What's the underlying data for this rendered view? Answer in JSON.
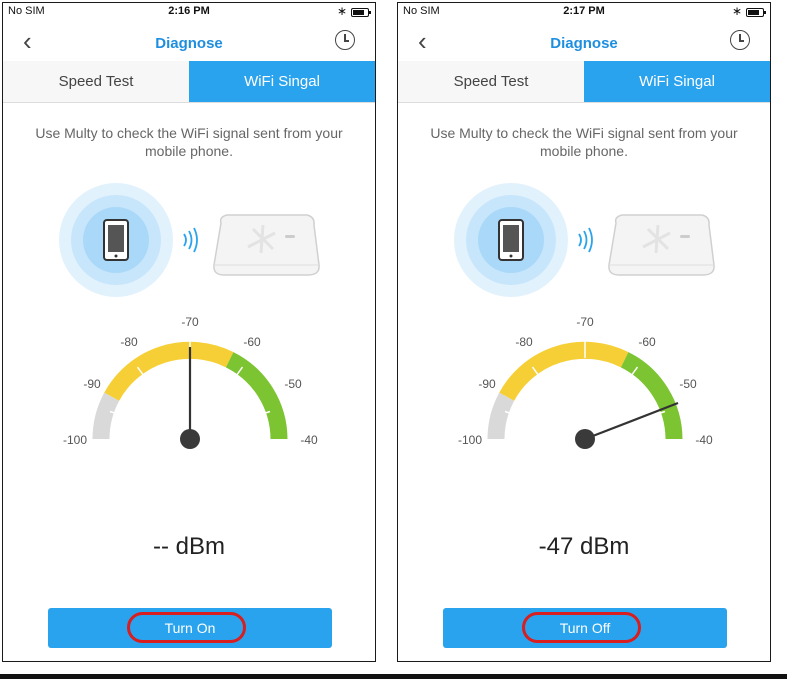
{
  "screens": [
    {
      "status": {
        "carrier": "No SIM",
        "time": "2:16 PM"
      },
      "nav": {
        "title": "Diagnose"
      },
      "tabs": [
        "Speed Test",
        "WiFi Singal"
      ],
      "description": "Use Multy to check the WiFi signal sent from your mobile phone.",
      "gauge": {
        "labels": [
          "-100",
          "-90",
          "-80",
          "-70",
          "-60",
          "-50",
          "-40"
        ],
        "needle_value": -70
      },
      "reading": "-- dBm",
      "button": "Turn On"
    },
    {
      "status": {
        "carrier": "No SIM",
        "time": "2:17 PM"
      },
      "nav": {
        "title": "Diagnose"
      },
      "tabs": [
        "Speed Test",
        "WiFi Singal"
      ],
      "description": "Use Multy to check the WiFi signal sent from your mobile phone.",
      "gauge": {
        "labels": [
          "-100",
          "-90",
          "-80",
          "-70",
          "-60",
          "-50",
          "-40"
        ],
        "needle_value": -47
      },
      "reading": "-47 dBm",
      "button": "Turn Off"
    }
  ],
  "colors": {
    "accent": "#2aa3ee",
    "title": "#1e8fe0",
    "gauge_gray": "#d9d9d9",
    "gauge_yellow": "#f6cf36",
    "gauge_green": "#7cc432",
    "highlight": "#d81e1e"
  }
}
